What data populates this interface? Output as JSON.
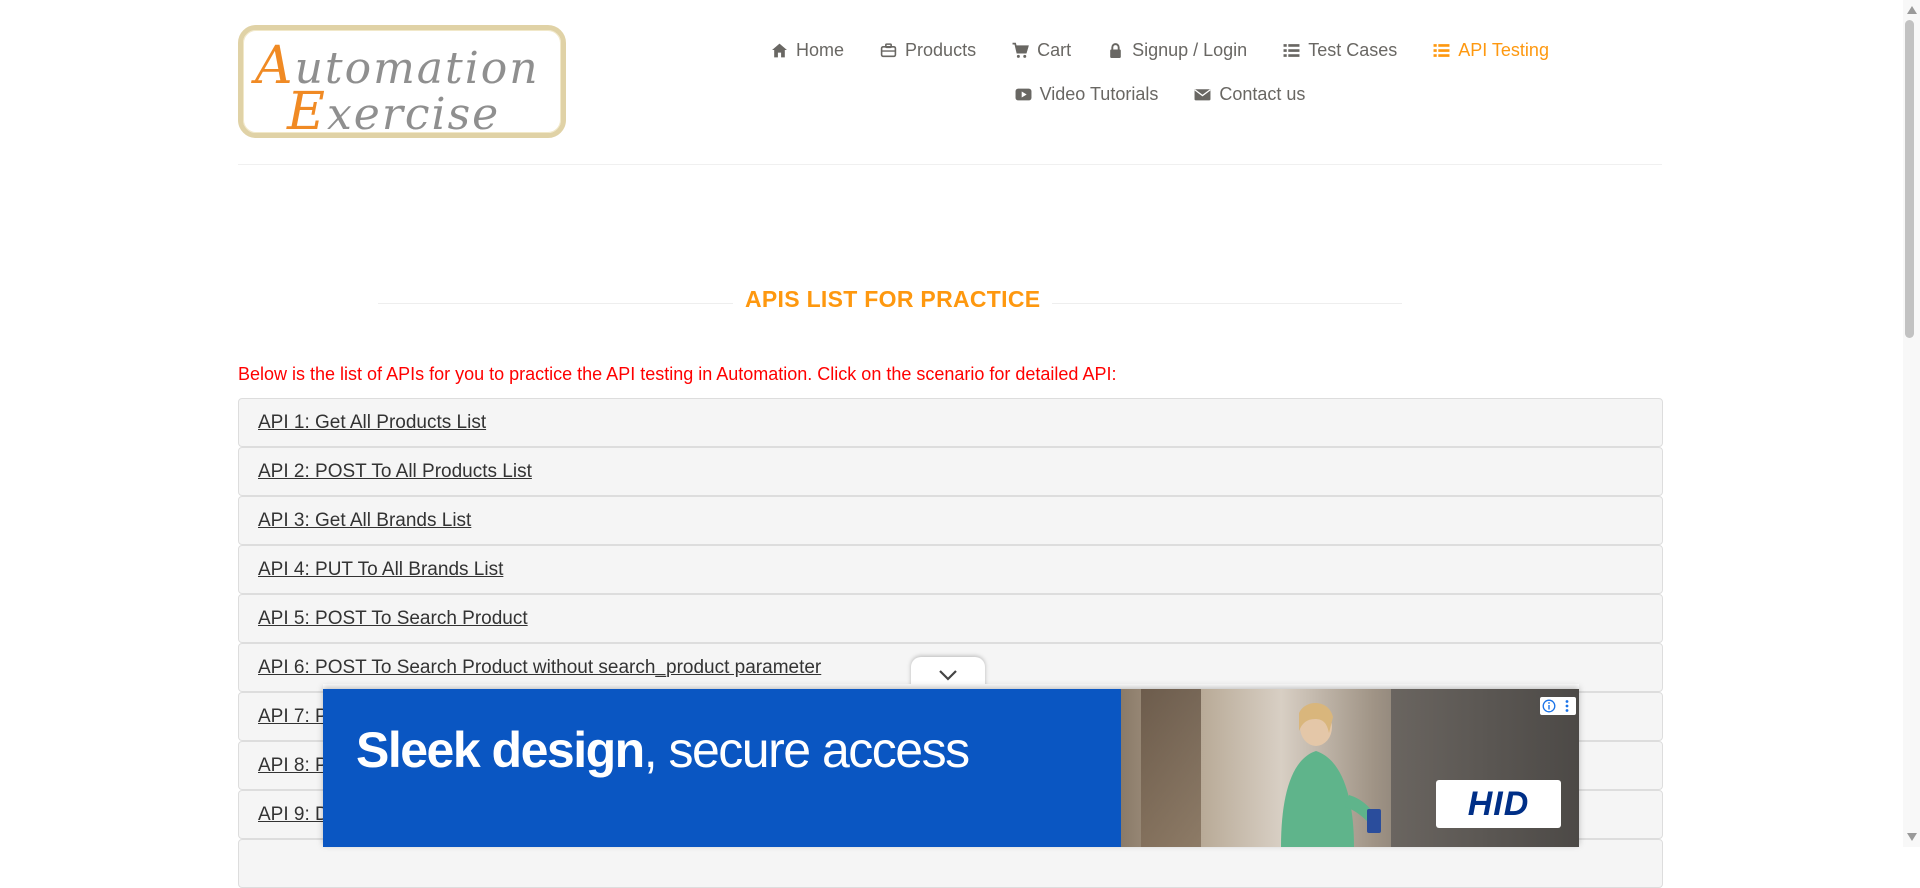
{
  "header": {
    "logo": {
      "line1_cap": "A",
      "line1_rest": "utomation",
      "line2_cap": "E",
      "line2_rest": "xercise"
    },
    "nav": [
      {
        "label": "Home",
        "icon": "home-icon",
        "active": false
      },
      {
        "label": "Products",
        "icon": "briefcase-icon",
        "active": false
      },
      {
        "label": "Cart",
        "icon": "cart-icon",
        "active": false
      },
      {
        "label": "Signup / Login",
        "icon": "lock-icon",
        "active": false
      },
      {
        "label": "Test Cases",
        "icon": "list-icon",
        "active": false
      },
      {
        "label": "API Testing",
        "icon": "list-icon",
        "active": true
      },
      {
        "label": "Video Tutorials",
        "icon": "youtube-icon",
        "active": false
      },
      {
        "label": "Contact us",
        "icon": "envelope-icon",
        "active": false
      }
    ]
  },
  "main": {
    "title": "APIS LIST FOR PRACTICE",
    "intro": "Below is the list of APIs for you to practice the API testing in Automation. Click on the scenario for detailed API:",
    "apis": [
      "API 1: Get All Products List",
      "API 2: POST To All Products List",
      "API 3: Get All Brands List",
      "API 4: PUT To All Brands List",
      "API 5: POST To Search Product",
      "API 6: POST To Search Product without search_product parameter",
      "API 7: P",
      "API 8: P",
      "API 9: D"
    ]
  },
  "ad": {
    "headline_bold": "Sleek design",
    "headline_rest": ", secure access",
    "brand": "HID",
    "colors": {
      "background": "#0a56c2",
      "brand_text": "#002f87"
    }
  },
  "colors": {
    "accent": "#fe980f",
    "intro_text": "#ff0000",
    "link_text": "#333333"
  }
}
